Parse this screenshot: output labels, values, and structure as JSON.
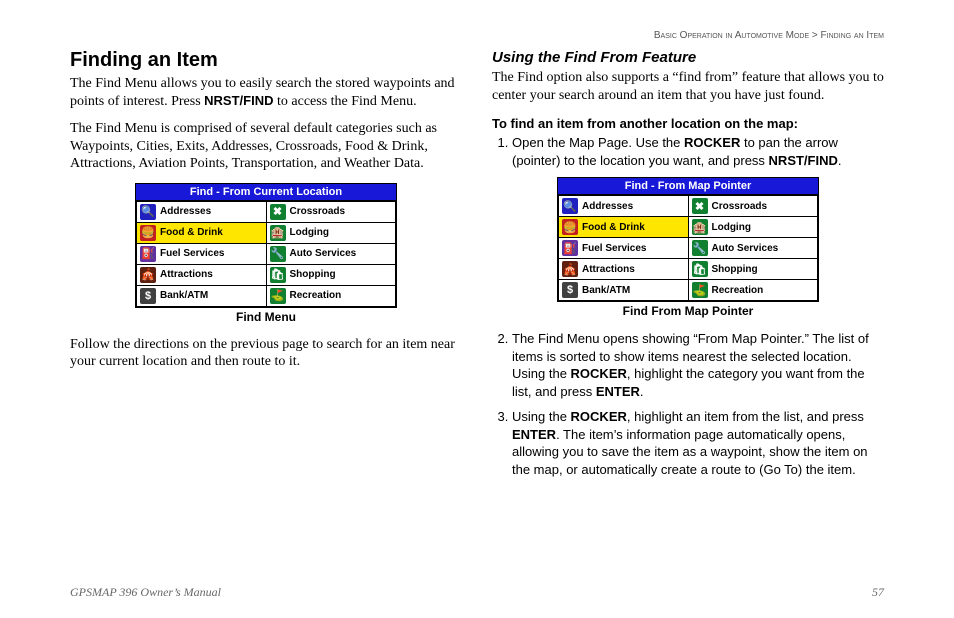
{
  "breadcrumb": {
    "section": "Basic Operation in Automotive Mode",
    "sep": ">",
    "page": "Finding an Item"
  },
  "left": {
    "heading": "Finding an Item",
    "p1a": "The Find Menu allows you to easily search the stored waypoints and points of interest. Press ",
    "p1b": "NRST/FIND",
    "p1c": " to access the Find Menu.",
    "p2": "The Find Menu is comprised of several default categories such as Waypoints, Cities, Exits, Addresses, Crossroads, Food & Drink, Attractions, Aviation Points, Transportation, and Weather Data.",
    "shot_title": "Find - From Current Location",
    "caption": "Find Menu",
    "p3": "Follow the directions on the previous page to search for an item near your current location and then route to it."
  },
  "right": {
    "heading": "Using the Find From Feature",
    "p1": "The Find option also supports a “find from” feature that allows you to center your search around an item that you have just found.",
    "sub": "To find an item from another location on the map:",
    "li1a": "Open the Map Page. Use the ",
    "li1b": "ROCKER",
    "li1c": " to pan the arrow (pointer) to the location you want, and press ",
    "li1d": "NRST/FIND",
    "li1e": ".",
    "shot_title": "Find - From Map Pointer",
    "caption": "Find From Map Pointer",
    "li2a": "The Find Menu opens showing “From Map Pointer.” The list of items is sorted to show items nearest the selected location. Using the ",
    "li2b": "ROCKER",
    "li2c": ", highlight the category you want from the list, and press ",
    "li2d": "ENTER",
    "li2e": ".",
    "li3a": "Using the ",
    "li3b": "ROCKER",
    "li3c": ", highlight an item from the list, and press ",
    "li3d": "ENTER",
    "li3e": ". The item’s information page automatically opens, allowing you to save the item as a waypoint, show the item on the map, or automatically create a route to (Go To) the item."
  },
  "grid": {
    "addresses": "Addresses",
    "crossroads": "Crossroads",
    "food": "Food & Drink",
    "lodging": "Lodging",
    "fuel": "Fuel Services",
    "auto": "Auto Services",
    "attractions": "Attractions",
    "shopping": "Shopping",
    "bank": "Bank/ATM",
    "recreation": "Recreation"
  },
  "icons": {
    "addresses": "🔍",
    "crossroads": "✖",
    "food": "🍔",
    "lodging": "🏨",
    "fuel": "⛽",
    "auto": "🔧",
    "attractions": "🎪",
    "shopping": "🛍",
    "bank": "$",
    "recreation": "⛳"
  },
  "footer": {
    "manual": "GPSMAP 396 Owner’s Manual",
    "page": "57"
  }
}
